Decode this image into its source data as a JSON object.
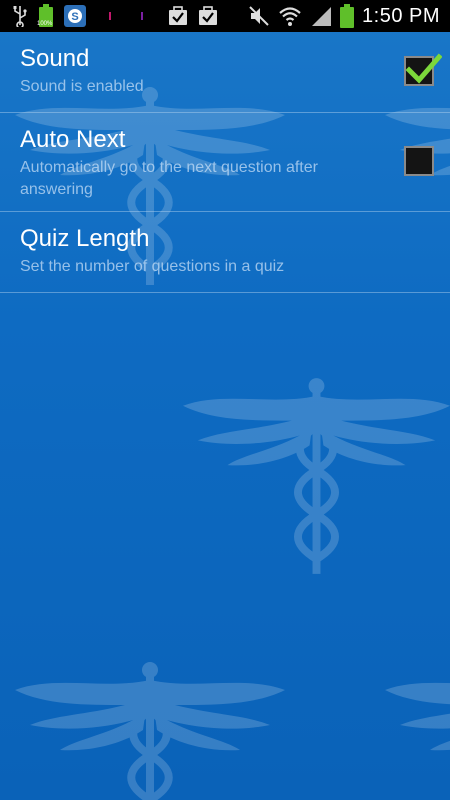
{
  "status_bar": {
    "time": "1:50 PM",
    "battery_small_label": "100%",
    "icons": [
      "usb-icon",
      "battery-small-icon",
      "skype-icon",
      "notification-dot-icon",
      "notification-dot-icon",
      "briefcase-check-icon",
      "briefcase-check-icon",
      "mute-icon",
      "wifi-icon",
      "signal-icon",
      "battery-icon"
    ]
  },
  "preferences": [
    {
      "title": "Sound",
      "summary": "Sound is enabled",
      "checked": true
    },
    {
      "title": "Auto Next",
      "summary": "Automatically go to the next question after answering",
      "checked": false
    },
    {
      "title": "Quiz Length",
      "summary": "Set the number of questions in a quiz"
    }
  ],
  "colors": {
    "background": "#0E6BC2",
    "check_green": "#7CD83B",
    "statusbar": "#000000"
  }
}
